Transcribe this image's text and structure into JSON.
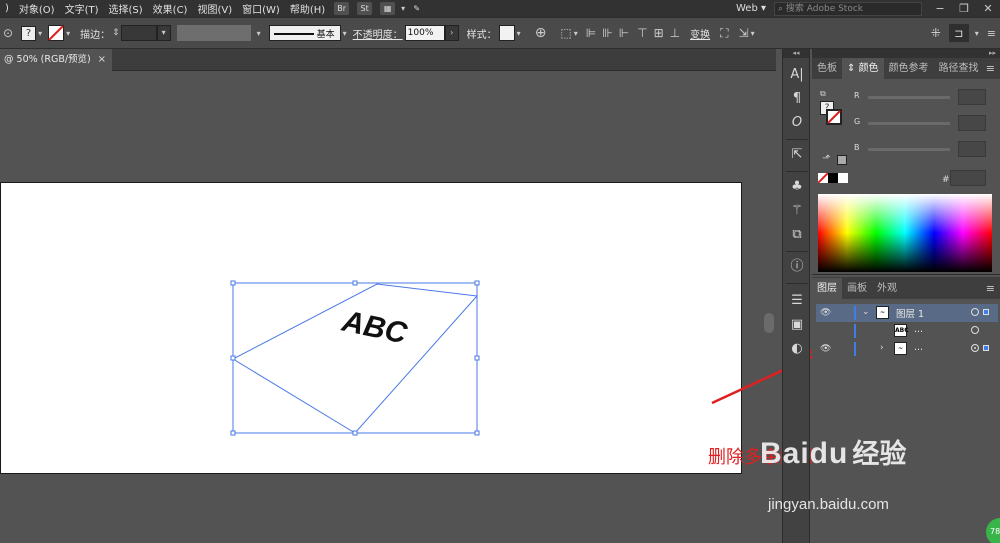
{
  "menubar": {
    "items": [
      "对象(O)",
      "文字(T)",
      "选择(S)",
      "效果(C)",
      "视图(V)",
      "窗口(W)",
      "帮助(H)"
    ],
    "app_icons": [
      "Br",
      "St"
    ],
    "workspace": "Web",
    "stock_placeholder": "搜索 Adobe Stock",
    "window_min": "−",
    "window_restore": "❐",
    "window_close": "✕"
  },
  "controlbar": {
    "stroke_label": "描边：",
    "stroke_profile": "基本",
    "opacity_label": "不透明度：",
    "opacity_value": "100%",
    "style_label": "样式：",
    "transform_label": "变换"
  },
  "document_tab": {
    "title": "@ 50% (RGB/预览)",
    "close": "×"
  },
  "artwork": {
    "text": "ABC",
    "selection_color": "#4a78e8"
  },
  "color_panel": {
    "tabs": [
      "色板",
      "颜色",
      "颜色参考",
      "路径查找"
    ],
    "active_tab": "颜色",
    "channels": [
      "R",
      "G",
      "B"
    ],
    "hex_label": "#",
    "menu_icon": "≡"
  },
  "layers_panel": {
    "tabs": [
      "图层",
      "画板",
      "外观"
    ],
    "active_tab": "图层",
    "rows": [
      {
        "name": "图层 1",
        "thumb": "~",
        "expanded": true,
        "selected": true
      },
      {
        "name": "...",
        "thumb": "ABC",
        "expanded": false,
        "selected": false
      },
      {
        "name": "...",
        "thumb": "~",
        "expanded": false,
        "selected": false
      }
    ]
  },
  "annotation": {
    "text": "删除多余图层",
    "color": "#e02020"
  },
  "watermark": {
    "brand": "Baidu",
    "product": "经验",
    "url": "jingyan.baidu.com"
  },
  "badge": "78"
}
